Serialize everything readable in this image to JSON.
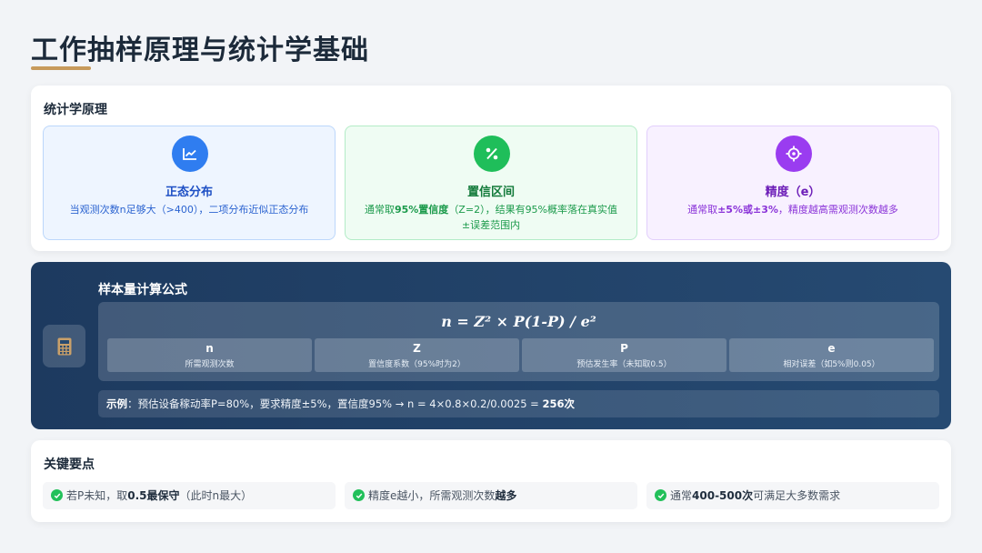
{
  "title": "工作抽样原理与统计学基础",
  "principles": {
    "heading": "统计学原理",
    "items": [
      {
        "title": "正态分布",
        "desc": "当观测次数n足够大（>400），二项分布近似正态分布",
        "icon": "chart-line-icon",
        "color": "#2f7df0"
      },
      {
        "title": "置信区间",
        "desc_pre": "通常取",
        "desc_bold": "95%置信度",
        "desc_post": "（Z=2），结果有95%概率落在真实值±误差范围内",
        "icon": "percent-icon",
        "color": "#1fbe5a"
      },
      {
        "title": "精度（e）",
        "desc_pre": "通常取",
        "desc_bold": "±5%或±3%",
        "desc_post": "，精度越高需观测次数越多",
        "icon": "crosshair-icon",
        "color": "#9a3cf0"
      }
    ]
  },
  "formula": {
    "heading": "样本量计算公式",
    "expression": "n = Z² × P(1-P) / e²",
    "variables": [
      {
        "symbol": "n",
        "desc": "所需观测次数"
      },
      {
        "symbol": "Z",
        "desc": "置信度系数（95%时为2）"
      },
      {
        "symbol": "P",
        "desc": "预估发生率（未知取0.5）"
      },
      {
        "symbol": "e",
        "desc": "相对误差（如5%则0.05）"
      }
    ],
    "example_label": "示例",
    "example_text": "：预估设备稼动率P=80%，要求精度±5%，置信度95% → n = 4×0.8×0.2/0.0025 = ",
    "example_result": "256次"
  },
  "key_points": {
    "heading": "关键要点",
    "items": [
      {
        "pre": "若P未知，取",
        "bold": "0.5最保守",
        "post": "（此时n最大）"
      },
      {
        "pre": "精度e越小，所需观测次数",
        "bold": "越多",
        "post": ""
      },
      {
        "pre": "通常",
        "bold": "400-500次",
        "post": "可满足大多数需求"
      }
    ]
  }
}
